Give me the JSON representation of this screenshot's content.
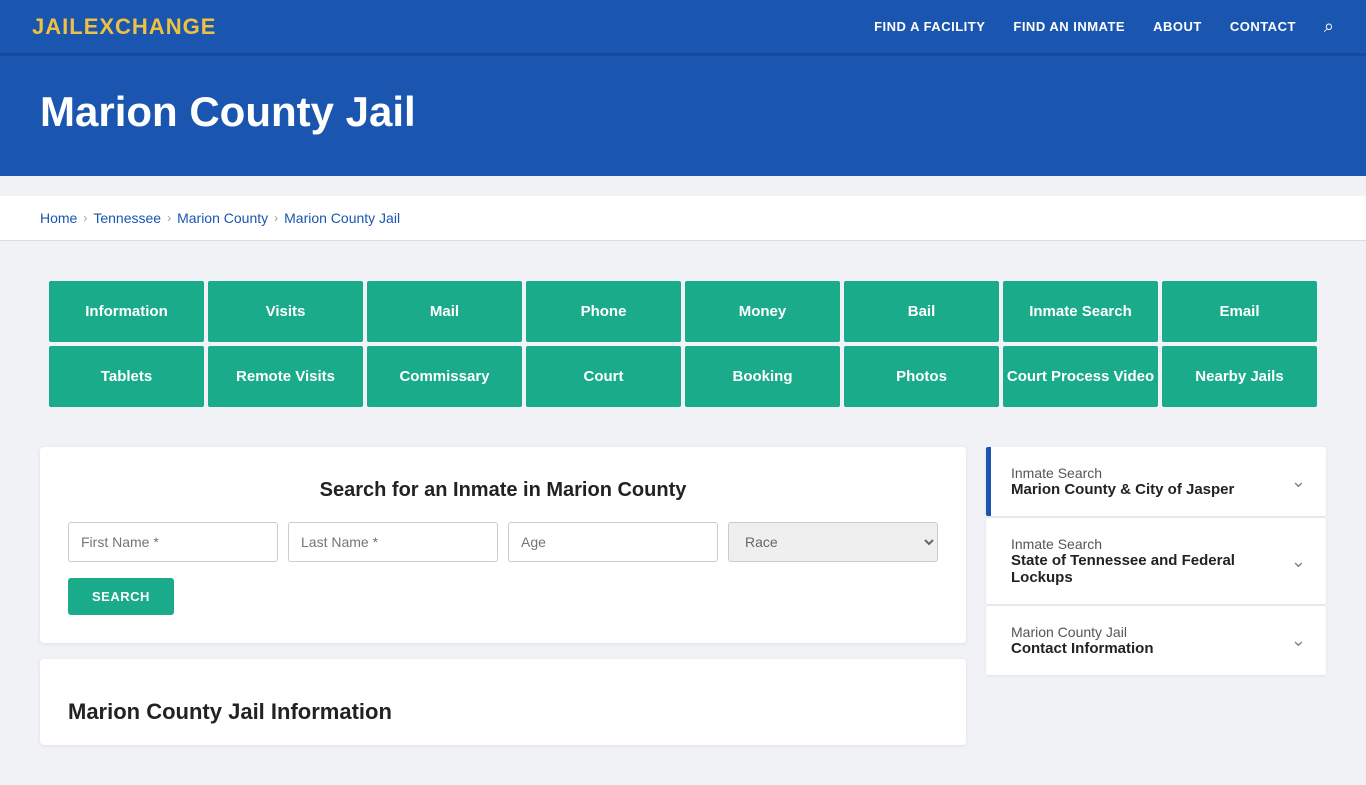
{
  "brand": {
    "name_part1": "JAIL",
    "name_part2": "EXCHANGE"
  },
  "nav": {
    "links": [
      {
        "label": "FIND A FACILITY",
        "href": "#"
      },
      {
        "label": "FIND AN INMATE",
        "href": "#"
      },
      {
        "label": "ABOUT",
        "href": "#"
      },
      {
        "label": "CONTACT",
        "href": "#"
      }
    ]
  },
  "hero": {
    "title": "Marion County Jail"
  },
  "breadcrumb": {
    "items": [
      {
        "label": "Home",
        "href": "#"
      },
      {
        "label": "Tennessee",
        "href": "#"
      },
      {
        "label": "Marion County",
        "href": "#"
      },
      {
        "label": "Marion County Jail",
        "href": "#"
      }
    ]
  },
  "grid_buttons": [
    "Information",
    "Visits",
    "Mail",
    "Phone",
    "Money",
    "Bail",
    "Inmate Search",
    "Email",
    "Tablets",
    "Remote Visits",
    "Commissary",
    "Court",
    "Booking",
    "Photos",
    "Court Process Video",
    "Nearby Jails"
  ],
  "search": {
    "title": "Search for an Inmate in Marion County",
    "first_name_placeholder": "First Name *",
    "last_name_placeholder": "Last Name *",
    "age_placeholder": "Age",
    "race_placeholder": "Race",
    "button_label": "SEARCH"
  },
  "section_title": "Marion County Jail Information",
  "sidebar": {
    "items": [
      {
        "label": "Inmate Search",
        "sublabel": "Marion County & City of Jasper",
        "active": true
      },
      {
        "label": "Inmate Search",
        "sublabel": "State of Tennessee and Federal Lockups",
        "active": false
      },
      {
        "label": "Marion County Jail",
        "sublabel": "Contact Information",
        "active": false
      }
    ]
  },
  "colors": {
    "nav_bg": "#1a56b0",
    "teal": "#1aab8a",
    "accent_blue": "#1a56b0"
  }
}
